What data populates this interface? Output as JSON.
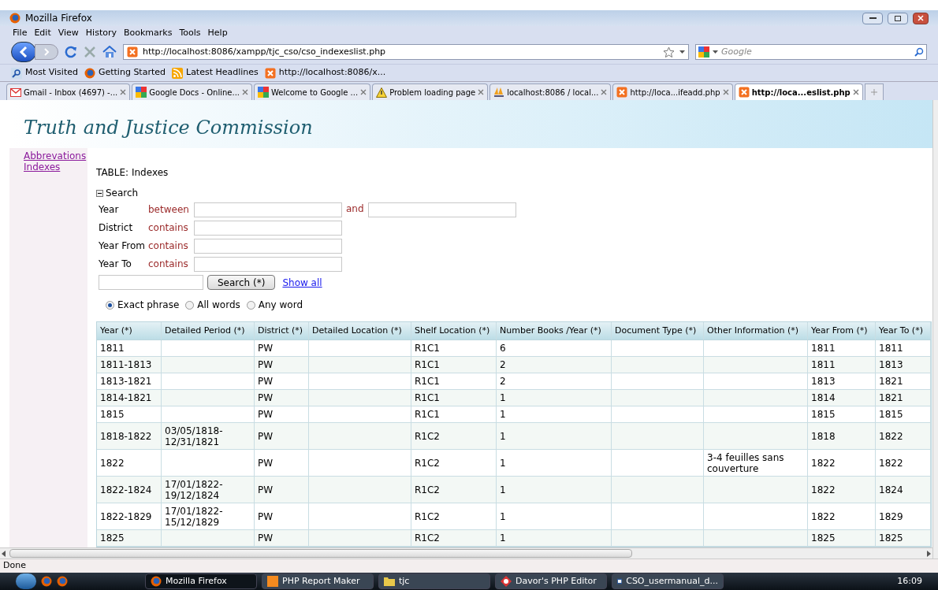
{
  "window": {
    "title": "Mozilla Firefox"
  },
  "menu": [
    "File",
    "Edit",
    "View",
    "History",
    "Bookmarks",
    "Tools",
    "Help"
  ],
  "address": {
    "url": "http://localhost:8086/xampp/tjc_cso/cso_indexeslist.php"
  },
  "web_search": {
    "placeholder": "Google"
  },
  "bookmarks": [
    {
      "label": "Most Visited",
      "kind": "search"
    },
    {
      "label": "Getting Started",
      "kind": "firefox"
    },
    {
      "label": "Latest Headlines",
      "kind": "rss"
    },
    {
      "label": "http://localhost:8086/x...",
      "kind": "xampp"
    }
  ],
  "tabs": [
    {
      "label": "Gmail - Inbox (4697) -...",
      "kind": "gmail",
      "selected": false
    },
    {
      "label": "Google Docs - Online...",
      "kind": "google",
      "selected": false
    },
    {
      "label": "Welcome to Google ...",
      "kind": "google",
      "selected": false
    },
    {
      "label": "Problem loading page",
      "kind": "warning",
      "selected": false
    },
    {
      "label": "localhost:8086 / local...",
      "kind": "pma",
      "selected": false
    },
    {
      "label": "http://loca...ifeadd.php",
      "kind": "xampp",
      "selected": false
    },
    {
      "label": "http://loca...eslist.php",
      "kind": "xampp",
      "selected": true
    }
  ],
  "page": {
    "title": "Truth and Justice Commission",
    "sidebar": {
      "items": [
        "Abbrevations",
        "Indexes"
      ]
    },
    "table_label": "TABLE: Indexes",
    "search": {
      "toggle": "Search",
      "expanded": true,
      "fields": [
        {
          "label": "Year",
          "operator": "between",
          "second_operator": "and"
        },
        {
          "label": "District",
          "operator": "contains"
        },
        {
          "label": "Year From",
          "operator": "contains"
        },
        {
          "label": "Year To",
          "operator": "contains"
        }
      ],
      "button": "Search (*)",
      "show_all": "Show all",
      "match_options": [
        {
          "label": "Exact phrase",
          "selected": true
        },
        {
          "label": "All words",
          "selected": false
        },
        {
          "label": "Any word",
          "selected": false
        }
      ]
    },
    "table": {
      "columns": [
        "Year (*)",
        "Detailed Period (*)",
        "District (*)",
        "Detailed Location (*)",
        "Shelf Location (*)",
        "Number Books /Year (*)",
        "Document Type (*)",
        "Other Information (*)",
        "Year From (*)",
        "Year To (*)"
      ],
      "rows": [
        [
          "1811",
          null,
          "PW",
          null,
          "R1C1",
          "6",
          null,
          null,
          "1811",
          "1811"
        ],
        [
          "1811-1813",
          null,
          "PW",
          null,
          "R1C1",
          "2",
          null,
          null,
          "1811",
          "1813"
        ],
        [
          "1813-1821",
          null,
          "PW",
          null,
          "R1C1",
          "2",
          null,
          null,
          "1813",
          "1821"
        ],
        [
          "1814-1821",
          null,
          "PW",
          null,
          "R1C1",
          "1",
          null,
          null,
          "1814",
          "1821"
        ],
        [
          "1815",
          null,
          "PW",
          null,
          "R1C1",
          "1",
          null,
          null,
          "1815",
          "1815"
        ],
        [
          "1818-1822",
          "03/05/1818-12/31/1821",
          "PW",
          null,
          "R1C2",
          "1",
          null,
          null,
          "1818",
          "1822"
        ],
        [
          "1822",
          null,
          "PW",
          null,
          "R1C2",
          "1",
          null,
          "3-4 feuilles sans couverture",
          "1822",
          "1822"
        ],
        [
          "1822-1824",
          "17/01/1822-19/12/1824",
          "PW",
          null,
          "R1C2",
          "1",
          null,
          null,
          "1822",
          "1824"
        ],
        [
          "1822-1829",
          "17/01/1822-15/12/1829",
          "PW",
          null,
          "R1C2",
          "1",
          null,
          null,
          "1822",
          "1829"
        ],
        [
          "1825",
          null,
          "PW",
          null,
          "R1C2",
          "1",
          null,
          null,
          "1825",
          "1825"
        ]
      ]
    }
  },
  "status_bar": "Done",
  "taskbar": {
    "items": [
      {
        "label": "Mozilla Firefox",
        "kind": "firefox",
        "selected": true
      },
      {
        "label": "PHP Report Maker",
        "kind": "report",
        "selected": false
      },
      {
        "label": "tjc",
        "kind": "folder",
        "selected": false
      },
      {
        "label": "Davor's PHP Editor",
        "kind": "editor",
        "selected": false
      },
      {
        "label": "CSO_usermanual_d...",
        "kind": "word",
        "selected": false
      }
    ],
    "clock": "16:09"
  }
}
